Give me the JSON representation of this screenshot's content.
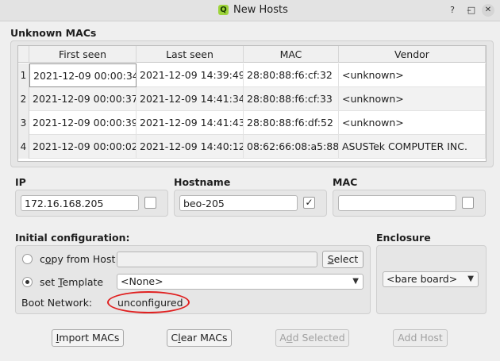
{
  "window": {
    "title": "New Hosts",
    "app_icon_letter": "Q",
    "controls": [
      "?",
      "–",
      "□",
      "✕"
    ]
  },
  "unknown_macs": {
    "title": "Unknown MACs",
    "columns": [
      "First seen",
      "Last seen",
      "MAC",
      "Vendor"
    ],
    "rows": [
      {
        "num": "1",
        "first_seen": "2021-12-09 00:00:34",
        "last_seen": "2021-12-09 14:39:49",
        "mac": "28:80:88:f6:cf:32",
        "vendor": "<unknown>"
      },
      {
        "num": "2",
        "first_seen": "2021-12-09 00:00:37",
        "last_seen": "2021-12-09 14:41:34",
        "mac": "28:80:88:f6:cf:33",
        "vendor": "<unknown>"
      },
      {
        "num": "3",
        "first_seen": "2021-12-09 00:00:39",
        "last_seen": "2021-12-09 14:41:43",
        "mac": "28:80:88:f6:df:52",
        "vendor": "<unknown>"
      },
      {
        "num": "4",
        "first_seen": "2021-12-09 00:00:02",
        "last_seen": "2021-12-09 14:40:12",
        "mac": "08:62:66:08:a5:88",
        "vendor": "ASUSTek COMPUTER INC."
      }
    ]
  },
  "ip": {
    "label": "IP",
    "value": "172.16.168.205",
    "checked": false
  },
  "hostname": {
    "label": "Hostname",
    "value": "beo-205",
    "checked": true,
    "check_mark": "✓"
  },
  "mac": {
    "label": "MAC",
    "value": "",
    "checked": false
  },
  "initial_config": {
    "label": "Initial configuration:",
    "copy_from_host_label_pre": "c",
    "copy_from_host_label_u": "o",
    "copy_from_host_label_post": "py from Host",
    "copy_from_host_value": "",
    "select_pre": "",
    "select_u": "S",
    "select_post": "elect",
    "set_template_pre": "set ",
    "set_template_u": "T",
    "set_template_post": "emplate",
    "template_value": "<None>",
    "boot_network_label": "Boot Network:",
    "boot_network_value": "unconfigured"
  },
  "enclosure": {
    "label": "Enclosure",
    "value": "<bare board>"
  },
  "buttons": {
    "import_macs_u": "I",
    "import_macs_post": "mport MACs",
    "clear_macs_pre": "C",
    "clear_macs_u": "l",
    "clear_macs_post": "ear MACs",
    "add_selected_pre": "A",
    "add_selected_u": "d",
    "add_selected_post": "d Selected",
    "add_host": "Add Host"
  }
}
